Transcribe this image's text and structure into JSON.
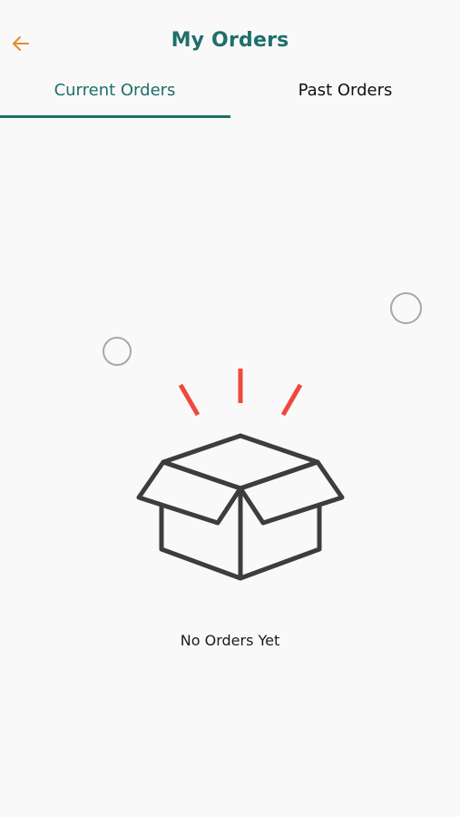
{
  "header": {
    "title": "My Orders",
    "back_icon": "arrow-left-icon",
    "accent_color": "#1f6f6b",
    "back_color": "#e58a2b"
  },
  "tabs": [
    {
      "label": "Current Orders",
      "active": true
    },
    {
      "label": "Past Orders",
      "active": false
    }
  ],
  "empty_state": {
    "icon": "open-box-icon",
    "message": "No Orders Yet",
    "box_color": "#3d3d3d",
    "spark_color": "#f2473c"
  }
}
